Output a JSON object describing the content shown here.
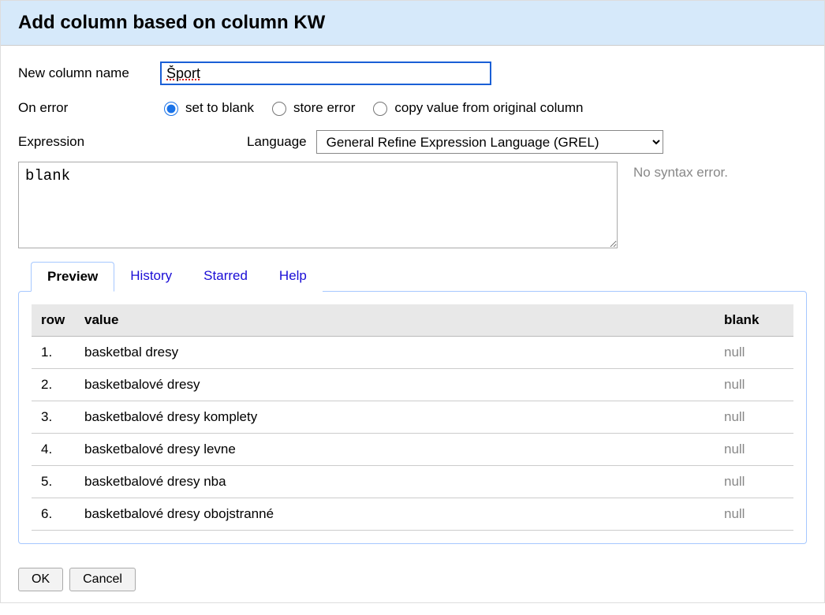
{
  "header": {
    "title": "Add column based on column KW"
  },
  "form": {
    "column_name_label": "New column name",
    "column_name_value": "Šport",
    "on_error_label": "On error",
    "error_options": {
      "blank": "set to blank",
      "store": "store error",
      "copy": "copy value from original column"
    },
    "expression_label": "Expression",
    "language_label": "Language",
    "language_value": "General Refine Expression Language (GREL)",
    "expression_value": "blank",
    "syntax_message": "No syntax error."
  },
  "tabs": {
    "preview": "Preview",
    "history": "History",
    "starred": "Starred",
    "help": "Help"
  },
  "preview": {
    "headers": {
      "row": "row",
      "value": "value",
      "result": "blank"
    },
    "rows": [
      {
        "n": "1.",
        "value": "basketbal dresy",
        "result": "null"
      },
      {
        "n": "2.",
        "value": "basketbalové dresy",
        "result": "null"
      },
      {
        "n": "3.",
        "value": "basketbalové dresy komplety",
        "result": "null"
      },
      {
        "n": "4.",
        "value": "basketbalové dresy levne",
        "result": "null"
      },
      {
        "n": "5.",
        "value": "basketbalové dresy nba",
        "result": "null"
      },
      {
        "n": "6.",
        "value": "basketbalové dresy obojstranné",
        "result": "null"
      }
    ]
  },
  "footer": {
    "ok": "OK",
    "cancel": "Cancel"
  }
}
